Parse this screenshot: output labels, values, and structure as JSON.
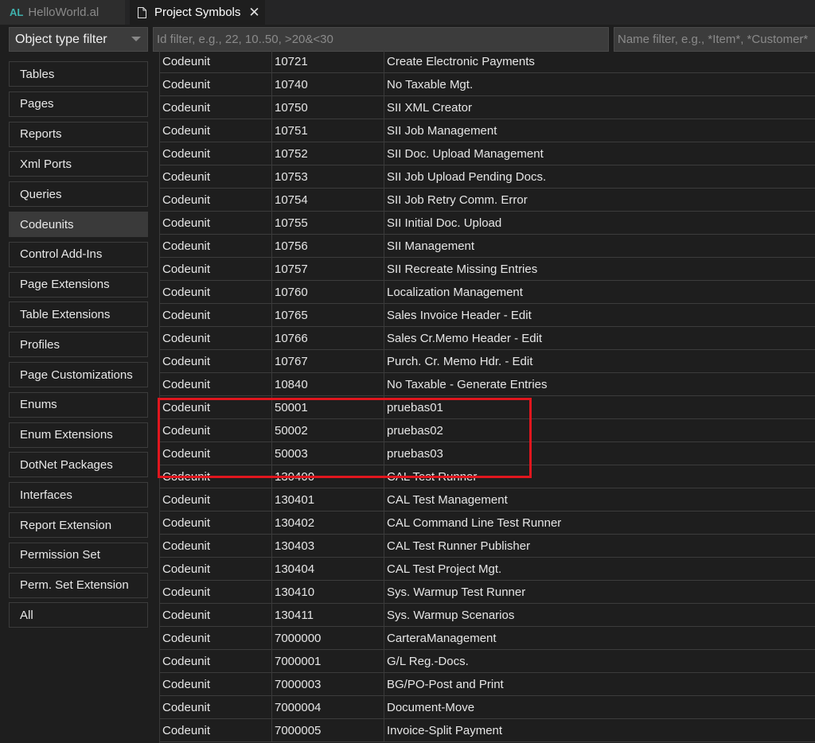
{
  "tabs": [
    {
      "badge": "AL",
      "label": "HelloWorld.al"
    },
    {
      "label": "Project Symbols",
      "close": "✕"
    }
  ],
  "filters": {
    "object_type": "Object type filter",
    "id_placeholder": "Id filter, e.g., 22, 10..50, >20&<30",
    "name_placeholder": "Name filter, e.g., *Item*, *Customer*"
  },
  "sidebar": {
    "active": "Codeunits",
    "items": [
      "Tables",
      "Pages",
      "Reports",
      "Xml Ports",
      "Queries",
      "Codeunits",
      "Control Add-Ins",
      "Page Extensions",
      "Table Extensions",
      "Profiles",
      "Page Customizations",
      "Enums",
      "Enum Extensions",
      "DotNet Packages",
      "Interfaces",
      "Report Extension",
      "Permission Set",
      "Perm. Set Extension",
      "All"
    ]
  },
  "rows": [
    [
      "Codeunit",
      "10721",
      "Create Electronic Payments"
    ],
    [
      "Codeunit",
      "10740",
      "No Taxable Mgt."
    ],
    [
      "Codeunit",
      "10750",
      "SII XML Creator"
    ],
    [
      "Codeunit",
      "10751",
      "SII Job Management"
    ],
    [
      "Codeunit",
      "10752",
      "SII Doc. Upload Management"
    ],
    [
      "Codeunit",
      "10753",
      "SII Job Upload Pending Docs."
    ],
    [
      "Codeunit",
      "10754",
      "SII Job Retry Comm. Error"
    ],
    [
      "Codeunit",
      "10755",
      "SII Initial Doc. Upload"
    ],
    [
      "Codeunit",
      "10756",
      "SII Management"
    ],
    [
      "Codeunit",
      "10757",
      "SII Recreate Missing Entries"
    ],
    [
      "Codeunit",
      "10760",
      "Localization Management"
    ],
    [
      "Codeunit",
      "10765",
      "Sales Invoice Header - Edit"
    ],
    [
      "Codeunit",
      "10766",
      "Sales Cr.Memo Header - Edit"
    ],
    [
      "Codeunit",
      "10767",
      "Purch. Cr. Memo Hdr. - Edit"
    ],
    [
      "Codeunit",
      "10840",
      "No Taxable - Generate Entries"
    ],
    [
      "Codeunit",
      "50001",
      "pruebas01"
    ],
    [
      "Codeunit",
      "50002",
      "pruebas02"
    ],
    [
      "Codeunit",
      "50003",
      "pruebas03"
    ],
    [
      "Codeunit",
      "130400",
      "CAL Test Runner"
    ],
    [
      "Codeunit",
      "130401",
      "CAL Test Management"
    ],
    [
      "Codeunit",
      "130402",
      "CAL Command Line Test Runner"
    ],
    [
      "Codeunit",
      "130403",
      "CAL Test Runner Publisher"
    ],
    [
      "Codeunit",
      "130404",
      "CAL Test Project Mgt."
    ],
    [
      "Codeunit",
      "130410",
      "Sys. Warmup Test Runner"
    ],
    [
      "Codeunit",
      "130411",
      "Sys. Warmup Scenarios"
    ],
    [
      "Codeunit",
      "7000000",
      "CarteraManagement"
    ],
    [
      "Codeunit",
      "7000001",
      "G/L Reg.-Docs."
    ],
    [
      "Codeunit",
      "7000003",
      "BG/PO-Post and Print"
    ],
    [
      "Codeunit",
      "7000004",
      "Document-Move"
    ],
    [
      "Codeunit",
      "7000005",
      "Invoice-Split Payment"
    ]
  ],
  "colors": {
    "highlight": "#e0161e",
    "al_badge": "#3fb0ac"
  }
}
